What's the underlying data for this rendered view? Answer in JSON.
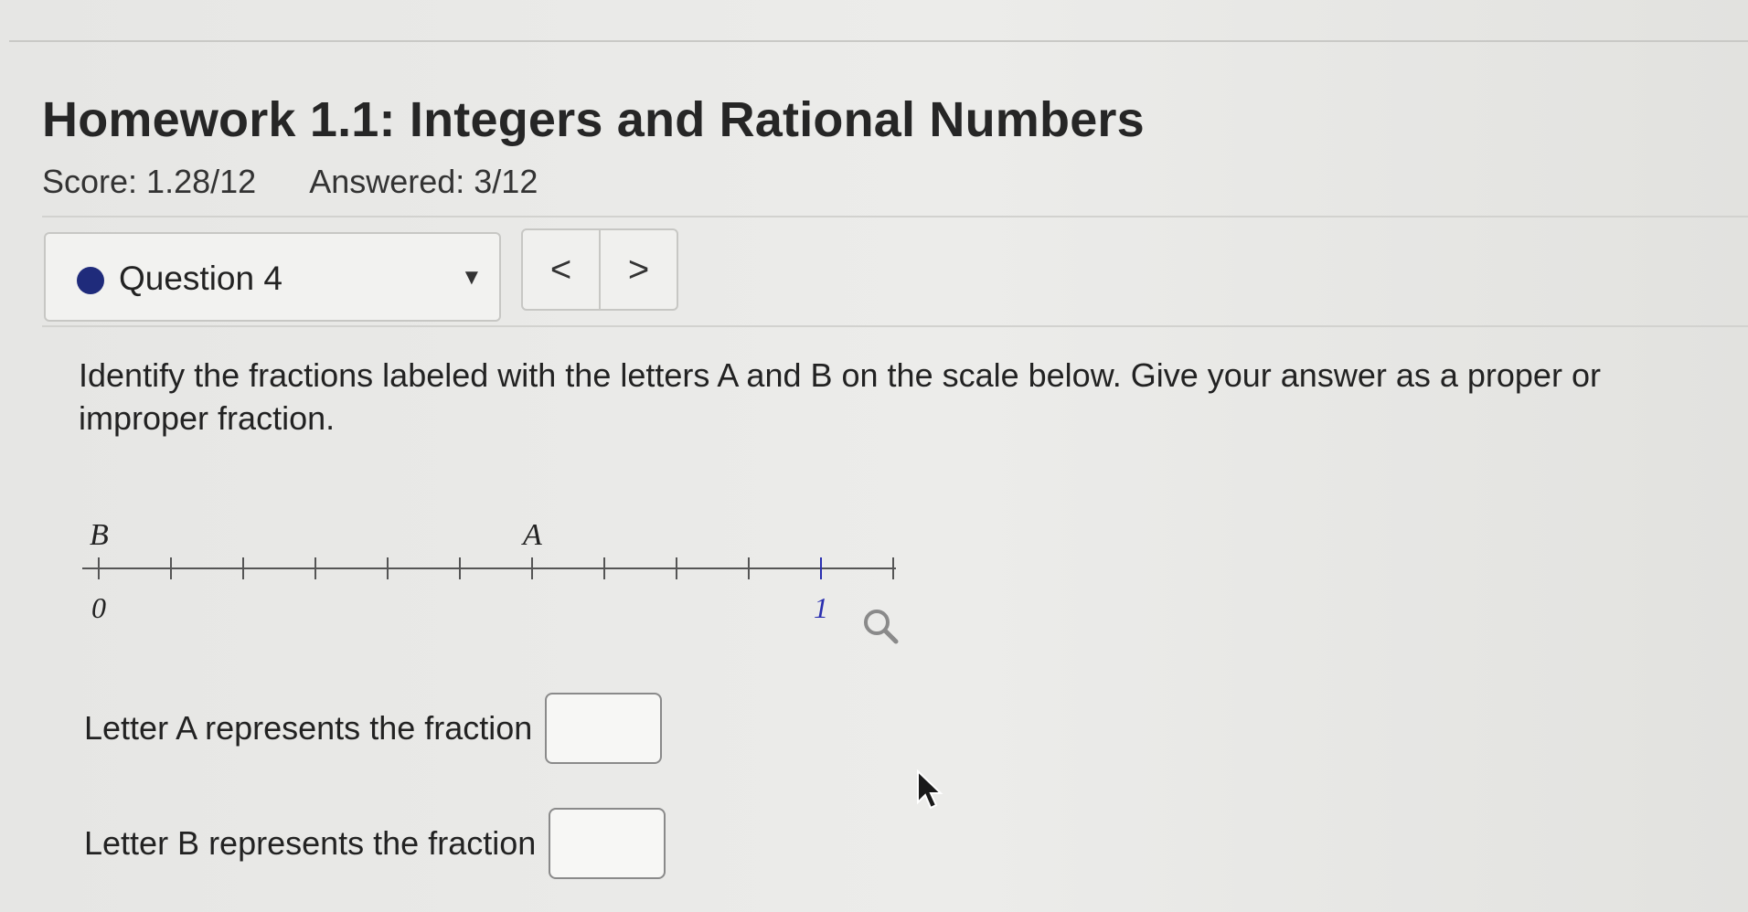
{
  "header": {
    "title": "Homework 1.1: Integers and Rational Numbers",
    "score": "Score: 1.28/12",
    "answered": "Answered: 3/12"
  },
  "question_nav": {
    "selected": "Question 4",
    "prev_label": "<",
    "next_label": ">"
  },
  "question": {
    "prompt": "Identify the fractions labeled with the letters A and B on the scale below. Give your answer as a proper or improper fraction.",
    "number_line": {
      "start_label": "0",
      "end_label": "1",
      "point_labels": [
        "B",
        "A"
      ],
      "divisions_to_one": 10,
      "A_position": 0.6,
      "B_position": 0.0
    },
    "answers": [
      {
        "label": "Letter A represents the fraction",
        "value": ""
      },
      {
        "label": "Letter B represents the fraction",
        "value": ""
      }
    ]
  },
  "icons": {
    "zoom": "magnifier-icon",
    "question_status": "filled-circle-icon",
    "dropdown": "caret-down-icon"
  },
  "colors": {
    "status_dot": "#1f2b7b",
    "one_tick": "#2a2fb0"
  }
}
